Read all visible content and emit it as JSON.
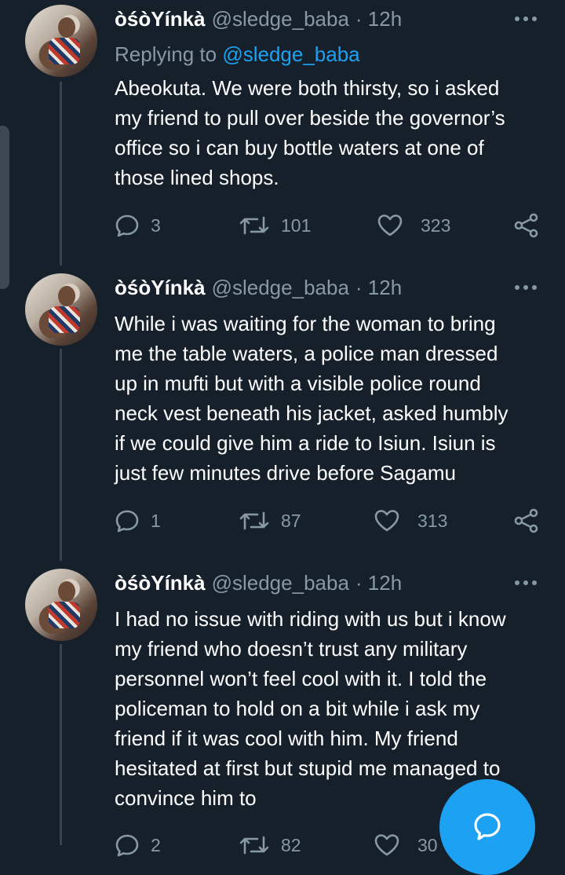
{
  "tweets": [
    {
      "author_name": "òśòYínkà",
      "handle": "@sledge_baba",
      "time": "· 12h",
      "replying_label": "Replying to",
      "replying_mention": "@sledge_baba",
      "lines": [
        "Abeokuta. We were both thirsty, so i asked",
        "my friend to pull over beside the governor’s",
        "office so i can buy bottle waters at one of",
        "those lined shops."
      ],
      "replies": "3",
      "retweets": "101",
      "likes": "323"
    },
    {
      "author_name": "òśòYínkà",
      "handle": "@sledge_baba",
      "time": "· 12h",
      "lines": [
        "While i was waiting for the woman to bring",
        "me the table waters, a police man dressed",
        "up in mufti but with a visible police round",
        "neck vest beneath his jacket, asked humbly",
        "if we could give him a ride to Isiun. Isiun is",
        "just few minutes drive before Sagamu"
      ],
      "replies": "1",
      "retweets": "87",
      "likes": "313"
    },
    {
      "author_name": "òśòYínkà",
      "handle": "@sledge_baba",
      "time": "· 12h",
      "lines": [
        "I had no issue with riding with us but i know",
        "my friend who doesn’t trust any military",
        "personnel won’t feel cool with it. I told the",
        "policeman to hold on a bit while i ask my",
        "friend if it was cool with him. My friend",
        "hesitated at first but stupid me managed to",
        "convince him to"
      ],
      "replies": "2",
      "retweets": "82",
      "likes": "30"
    }
  ],
  "icons": {
    "reply": "reply-icon",
    "retweet": "retweet-icon",
    "like": "heart-icon",
    "share": "share-icon",
    "more": "more-icon",
    "compose": "compose-icon"
  },
  "colors": {
    "background": "#15202b",
    "text": "#ffffff",
    "secondary": "#8899a6",
    "accent": "#1da1f2",
    "thread_line": "#38444d"
  }
}
